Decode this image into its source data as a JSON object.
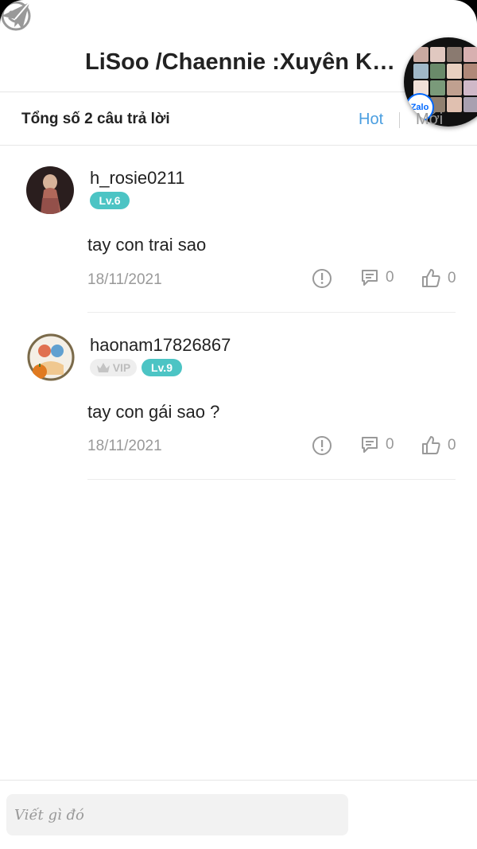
{
  "header": {
    "title": "LiSoo /Chaennie :Xuyên Kh..."
  },
  "zalo": {
    "label": "Zalo"
  },
  "subheader": {
    "count_text": "Tổng số 2 câu trả lời",
    "tab_hot": "Hot",
    "tab_new": "Mới"
  },
  "comments": [
    {
      "username": "h_rosie0211",
      "level": "Lv.6",
      "vip": null,
      "text": "tay con trai sao",
      "date": "18/11/2021",
      "reply_count": "0",
      "like_count": "0"
    },
    {
      "username": "haonam17826867",
      "level": "Lv.9",
      "vip": "VIP",
      "text": "tay con gái sao ?",
      "date": "18/11/2021",
      "reply_count": "0",
      "like_count": "0"
    }
  ],
  "composer": {
    "placeholder": "Viết gì đó"
  },
  "colors": {
    "level_badge": "#4cc4c4",
    "hot_tab": "#4a9ee0",
    "zalo_blue": "#0068ff"
  },
  "icons": {
    "report": "exclamation-circle-icon",
    "reply": "comment-icon",
    "like": "thumbs-up-icon",
    "emoji": "smile-icon",
    "send": "paper-plane-icon"
  }
}
